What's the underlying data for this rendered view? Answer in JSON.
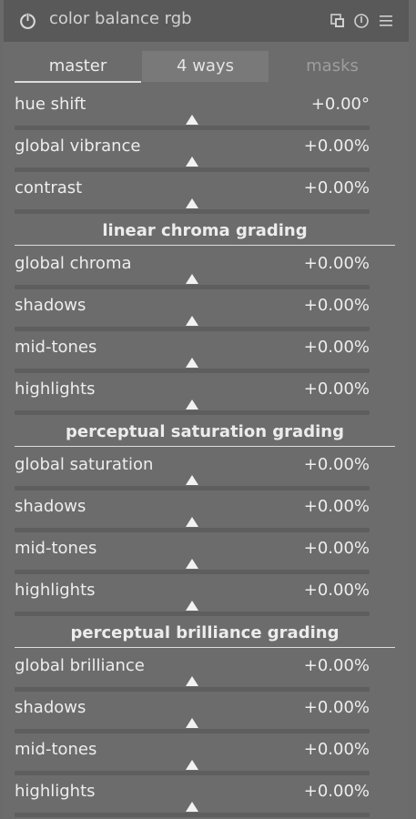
{
  "module": {
    "title": "color balance rgb"
  },
  "tabs": [
    "master",
    "4 ways",
    "masks"
  ],
  "sliders": {
    "hue_shift": {
      "label": "hue shift",
      "value": "+0.00°"
    },
    "global_vibrance": {
      "label": "global vibrance",
      "value": "+0.00%"
    },
    "contrast": {
      "label": "contrast",
      "value": "+0.00%"
    },
    "chroma_global": {
      "label": "global chroma",
      "value": "+0.00%"
    },
    "chroma_shadows": {
      "label": "shadows",
      "value": "+0.00%"
    },
    "chroma_midtones": {
      "label": "mid-tones",
      "value": "+0.00%"
    },
    "chroma_highlights": {
      "label": "highlights",
      "value": "+0.00%"
    },
    "sat_global": {
      "label": "global saturation",
      "value": "+0.00%"
    },
    "sat_shadows": {
      "label": "shadows",
      "value": "+0.00%"
    },
    "sat_midtones": {
      "label": "mid-tones",
      "value": "+0.00%"
    },
    "sat_highlights": {
      "label": "highlights",
      "value": "+0.00%"
    },
    "bril_global": {
      "label": "global brilliance",
      "value": "+0.00%"
    },
    "bril_shadows": {
      "label": "shadows",
      "value": "+0.00%"
    },
    "bril_midtones": {
      "label": "mid-tones",
      "value": "+0.00%"
    },
    "bril_highlights": {
      "label": "highlights",
      "value": "+0.00%"
    }
  },
  "sections": {
    "linear_chroma": "linear chroma grading",
    "perceptual_saturation": "perceptual saturation grading",
    "perceptual_brilliance": "perceptual brilliance grading"
  },
  "icons": {
    "power": "power-icon",
    "presets": "presets-icon",
    "reset": "reset-icon",
    "menu": "menu-icon"
  }
}
